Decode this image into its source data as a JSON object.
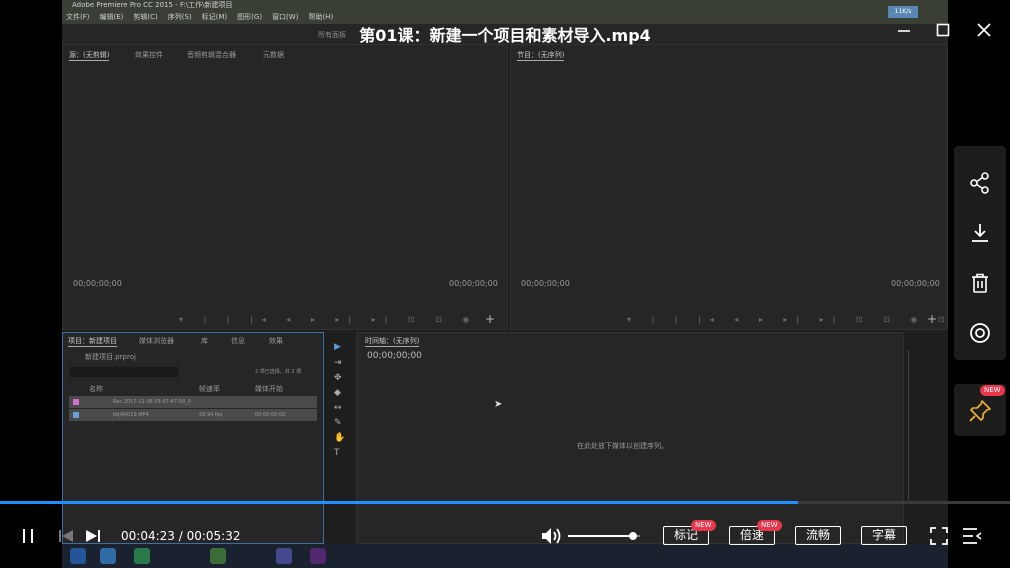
{
  "player": {
    "title": "第01课：新建一个项目和素材导入.mp4",
    "progress_fraction": 0.79,
    "volume_fraction": 0.9,
    "time_current": "00:04:23",
    "time_separator": " / ",
    "time_total": "00:05:32",
    "pills": {
      "mark": "标记",
      "speed": "倍速",
      "quality": "流畅",
      "subtitle": "字幕"
    },
    "new_badge": "NEW",
    "colors": {
      "accent": "#1e90ff",
      "badge": "#e8364a"
    }
  },
  "video": {
    "titlebar": "Adobe Premiere Pro CC 2015 - F:\\工作\\新建项目",
    "menus": [
      "文件(F)",
      "编辑(E)",
      "剪辑(C)",
      "序列(S)",
      "标记(M)",
      "图形(G)",
      "窗口(W)",
      "帮助(H)"
    ],
    "net_badge": "11K/s",
    "workspace_tab": "所有面板",
    "source_tabs": [
      "源：(无剪辑)",
      "效果控件",
      "音频剪辑混合器",
      "元数据"
    ],
    "program_tab": "节目：(无序列)",
    "timecode": "00;00;00;00",
    "project_tabs": [
      "项目：新建项目",
      "媒体浏览器",
      "库",
      "信息",
      "效果"
    ],
    "project_file": "新建项目.prproj",
    "project_count": "2 项已选择，共 2 项",
    "project_cols": [
      "名称",
      "帧速率",
      "媒体开始"
    ],
    "project_rows": [
      {
        "name": "Rec 2017-11-06 05-07-47-00_0",
        "fps": "",
        "start": "",
        "color": "#d06fd0"
      },
      {
        "name": "bbj40019.MP4",
        "fps": "59.94 fps",
        "start": "00:00:00:00",
        "color": "#6a9fd8"
      }
    ],
    "timeline_tab": "时间轴：(无序列)",
    "timeline_tc": "00;00;00;00",
    "timeline_hint": "在此处放下媒体以创建序列。"
  }
}
